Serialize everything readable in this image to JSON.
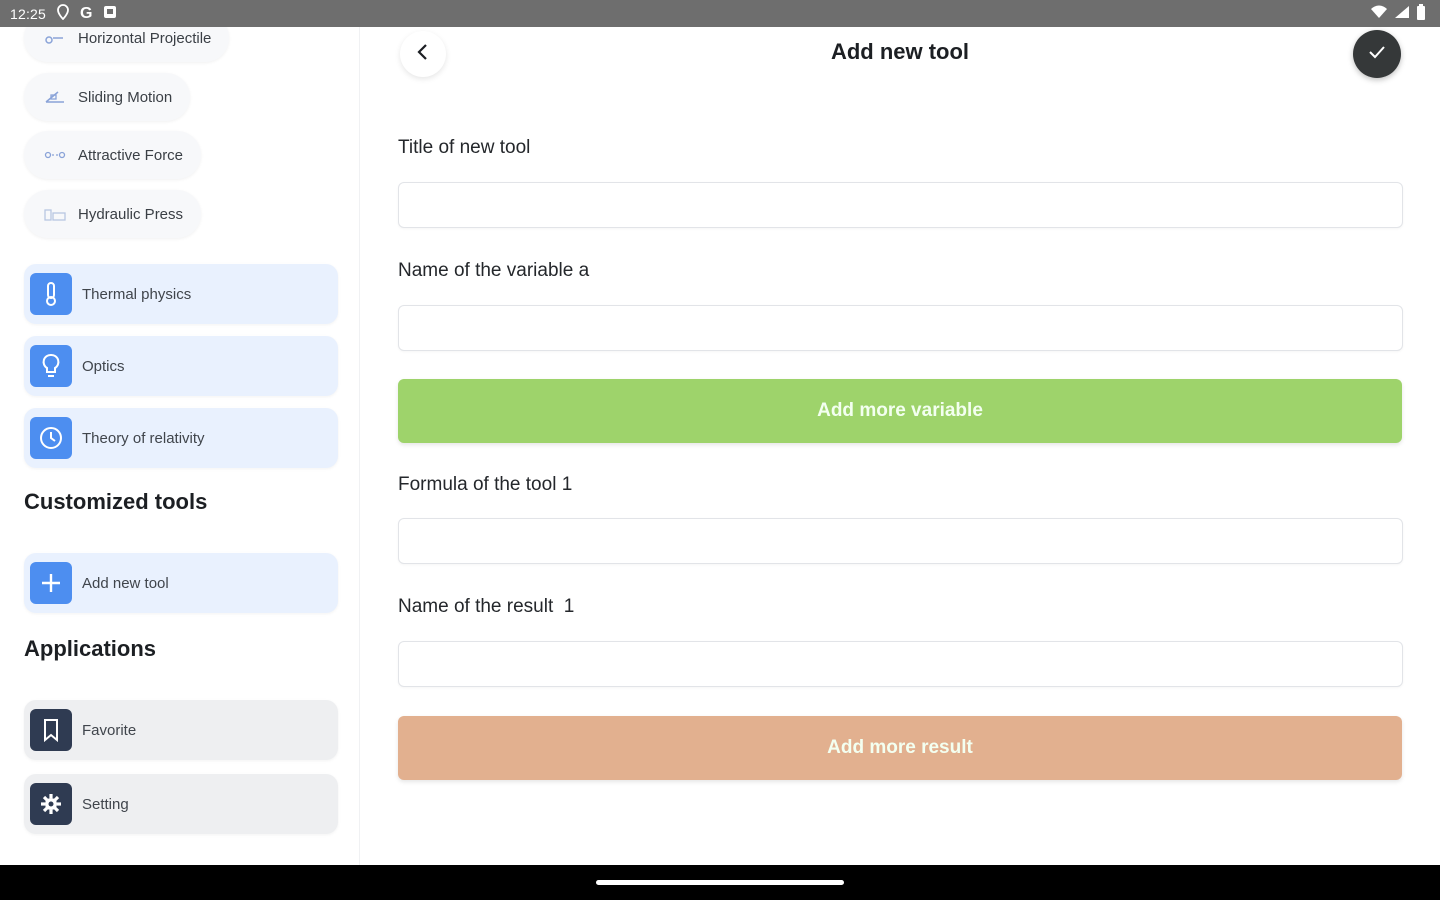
{
  "status_bar": {
    "time": "12:25",
    "icons_left": [
      "location-icon",
      "google-icon",
      "notification-icon"
    ],
    "icons_right": [
      "wifi-icon",
      "signal-icon",
      "battery-icon"
    ]
  },
  "sidebar": {
    "chips": [
      {
        "label": "Horizontal Projectile",
        "icon": "projectile-icon"
      },
      {
        "label": "Sliding Motion",
        "icon": "sliding-icon"
      },
      {
        "label": "Attractive Force",
        "icon": "force-icon"
      },
      {
        "label": "Hydraulic Press",
        "icon": "press-icon"
      }
    ],
    "categories": [
      {
        "label": "Thermal physics",
        "icon": "thermometer-icon"
      },
      {
        "label": "Optics",
        "icon": "lightbulb-icon"
      },
      {
        "label": "Theory of relativity",
        "icon": "clock-icon"
      }
    ],
    "customized_title": "Customized tools",
    "add_tool_label": "Add new tool",
    "applications_title": "Applications",
    "applications": [
      {
        "label": "Favorite",
        "icon": "bookmark-icon"
      },
      {
        "label": "Setting",
        "icon": "gear-icon"
      }
    ]
  },
  "main": {
    "title": "Add new tool",
    "fields": {
      "title_label": "Title of new tool",
      "variable_label": "Name of the variable a",
      "formula_label": "Formula of the tool 1",
      "result_label": "Name of the result  1"
    },
    "add_variable_label": "Add more variable",
    "add_result_label": "Add more result"
  },
  "colors": {
    "accent_blue": "#4d8ef0",
    "card_blue": "#e9f1fe",
    "green_button": "#9ed36b",
    "orange_button": "#e2b08f",
    "dark": "#353839"
  }
}
